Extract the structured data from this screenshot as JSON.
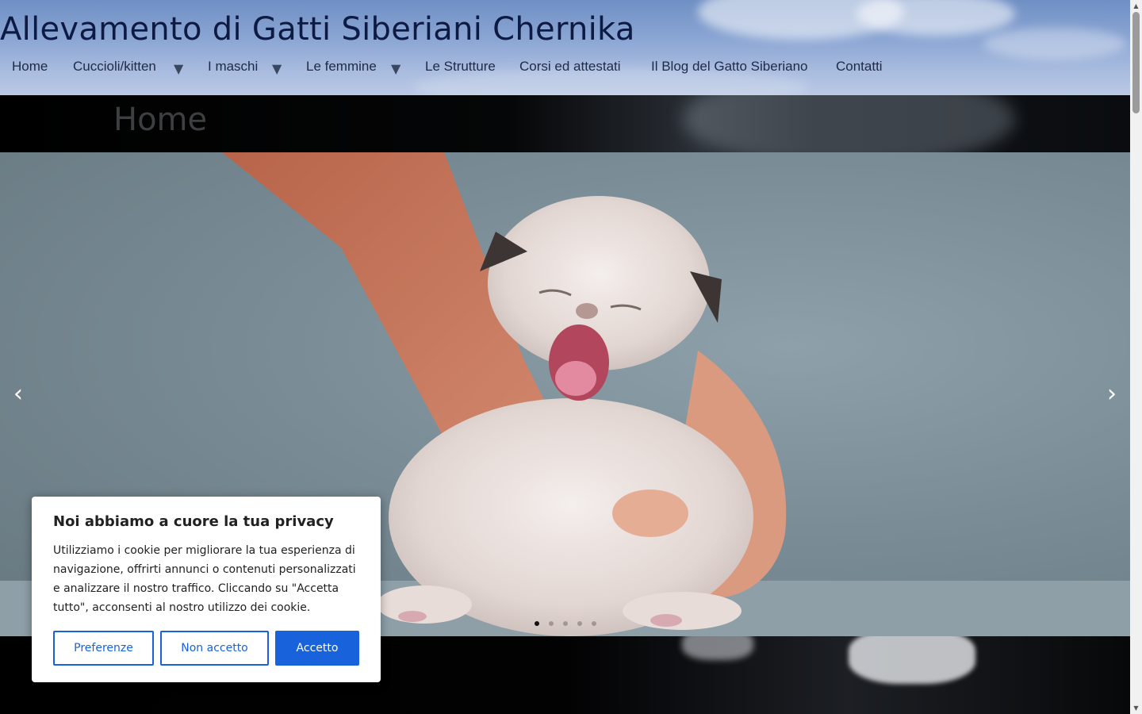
{
  "header": {
    "site_title": "Allevamento di Gatti Siberiani Chernika",
    "nav": [
      {
        "label": "Home",
        "has_submenu": false
      },
      {
        "label": "Cuccioli/kitten",
        "has_submenu": true
      },
      {
        "label": "I maschi",
        "has_submenu": true
      },
      {
        "label": "Le femmine",
        "has_submenu": true
      },
      {
        "label": "Le Strutture",
        "has_submenu": false
      },
      {
        "label": "Corsi ed attestati",
        "has_submenu": false
      },
      {
        "label": "Il Blog del Gatto Siberiano",
        "has_submenu": false
      },
      {
        "label": "Contatti",
        "has_submenu": false
      }
    ],
    "submenu_caret": "▼"
  },
  "page": {
    "title": "Home"
  },
  "slider": {
    "prev_icon": "‹",
    "next_icon": "›",
    "slide_count": 5,
    "active_slide": 1
  },
  "cookie_banner": {
    "title": "Noi abbiamo a cuore la tua privacy",
    "text": "Utilizziamo i cookie per migliorare la tua esperienza di navigazione, offrirti annunci o contenuti personalizzati e analizzare il nostro traffico. Cliccando su \"Accetta tutto\", acconsenti al nostro utilizzo dei cookie.",
    "buttons": {
      "preferences": "Preferenze",
      "reject": "Non accetto",
      "accept": "Accetto"
    },
    "accent_color": "#1863dc"
  },
  "colors": {
    "title_color": "#0c1a44",
    "nav_color": "#1e2a48"
  }
}
